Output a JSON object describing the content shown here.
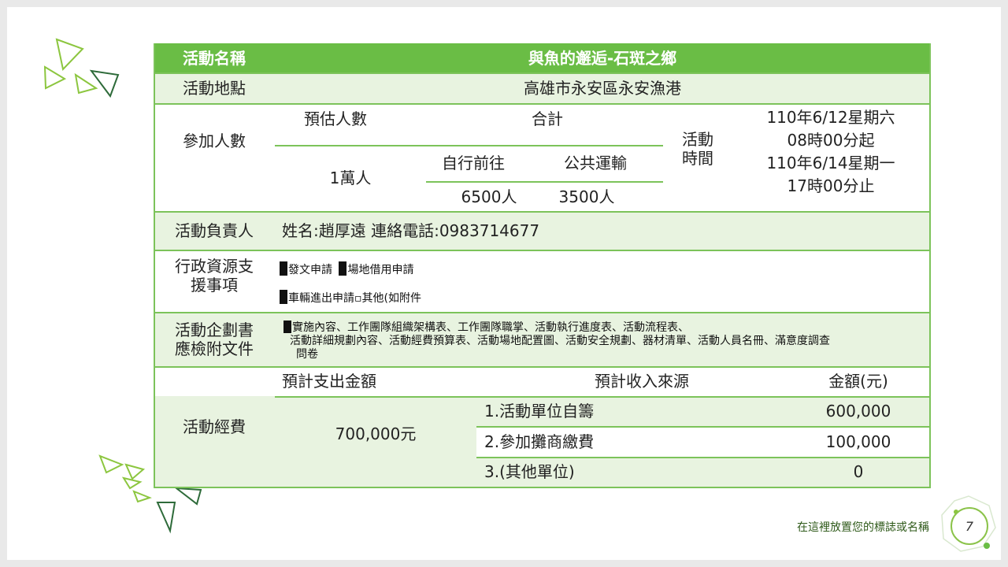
{
  "table": {
    "header": {
      "label": "活動名稱",
      "value": "與魚的邂逅-石斑之鄉"
    },
    "location": {
      "label": "活動地點",
      "value": "高雄市永安區永安漁港"
    },
    "participants": {
      "label": "參加人數",
      "estimate_label": "預估人數",
      "total_label": "合計",
      "estimate_value": "1萬人",
      "self_label": "自行前往",
      "public_label": "公共運輸",
      "self_value": "6500人",
      "public_value": "3500人"
    },
    "activity_time": {
      "label_line1": "活動",
      "label_line2": "時間",
      "line1": "110年6/12星期六",
      "line2": "08時00分起",
      "line3": "110年6/14星期一",
      "line4": "17時00分止"
    },
    "manager": {
      "label": "活動負責人",
      "value": "姓名:趙厚遠 連絡電話:0983714677"
    },
    "admin": {
      "label_line1": "行政資源支",
      "label_line2": "援事項",
      "item1": "發文申請",
      "item2": "場地借用申請",
      "item3": "車輛進出申請▫其他(如附件"
    },
    "plan": {
      "label_line1": "活動企劃書",
      "label_line2": "應檢附文件",
      "line1": "實施內容、工作團隊組織架構表、工作團隊職掌、活動執行進度表、活動流程表、",
      "line2": "活動詳細規劃內容、活動經費預算表、活動場地配置圖、活動安全規劃、器材清單、活動人員名冊、滿意度調查",
      "line3": "問卷"
    },
    "budget": {
      "label": "活動經費",
      "expense_label": "預計支出金額",
      "income_label": "預計收入來源",
      "amount_label": "金額(元)",
      "expense_value": "700,000元",
      "sources": [
        {
          "name": "1.活動單位自籌",
          "amount": "600,000"
        },
        {
          "name": "2.參加攤商繳費",
          "amount": "100,000"
        },
        {
          "name": "3.(其他單位)",
          "amount": "0"
        }
      ]
    }
  },
  "footer": {
    "text": "在這裡放置您的標誌或名稱",
    "page": "7"
  },
  "colors": {
    "accent": "#6abd45",
    "row_fill": "#e8f3e0",
    "line": "#7cc35a"
  },
  "icons": [
    "triangle-decoration-icon",
    "checkbox-filled-icon"
  ]
}
